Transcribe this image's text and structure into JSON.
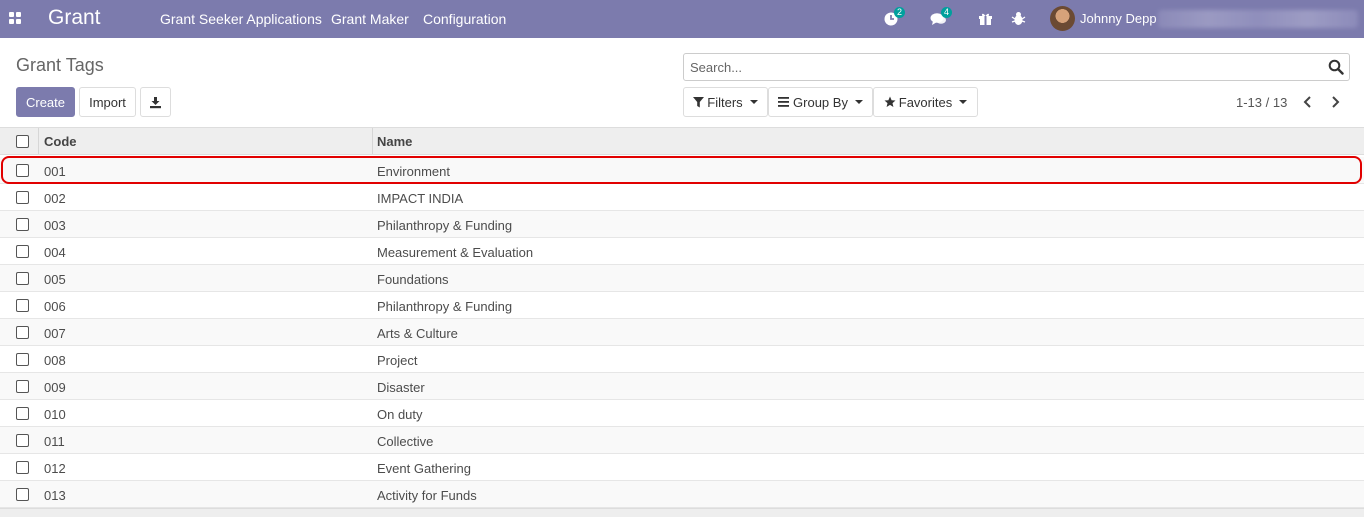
{
  "app": {
    "name": "Grant",
    "menu": [
      "Grant Seeker Applications",
      "Grant Maker",
      "Configuration"
    ]
  },
  "systray": {
    "activity_count": "2",
    "messages_count": "4",
    "user_name": "Johnny Depp"
  },
  "page": {
    "title": "Grant Tags",
    "create_label": "Create",
    "import_label": "Import",
    "search_placeholder": "Search...",
    "filters_label": "Filters",
    "groupby_label": "Group By",
    "favorites_label": "Favorites",
    "pager": "1-13 / 13"
  },
  "table": {
    "columns": [
      "Code",
      "Name"
    ],
    "rows": [
      {
        "code": "001",
        "name": "Environment"
      },
      {
        "code": "002",
        "name": "IMPACT INDIA"
      },
      {
        "code": "003",
        "name": "Philanthropy & Funding"
      },
      {
        "code": "004",
        "name": "Measurement & Evaluation"
      },
      {
        "code": "005",
        "name": "Foundations"
      },
      {
        "code": "006",
        "name": "Philanthropy & Funding"
      },
      {
        "code": "007",
        "name": "Arts & Culture"
      },
      {
        "code": "008",
        "name": "Project"
      },
      {
        "code": "009",
        "name": "Disaster"
      },
      {
        "code": "010",
        "name": "On duty"
      },
      {
        "code": "011",
        "name": "Collective"
      },
      {
        "code": "012",
        "name": "Event Gathering"
      },
      {
        "code": "013",
        "name": "Activity for Funds"
      }
    ]
  },
  "colors": {
    "navbar": "#7c7bad",
    "badge": "#00a09d",
    "highlight": "#e10000"
  },
  "icons": {
    "apps": "apps-grid-icon",
    "activity": "clock-icon",
    "messages": "chat-icon",
    "gift": "gift-icon",
    "debug": "bug-icon",
    "download": "download-icon",
    "search": "search-icon",
    "filters": "filter-icon",
    "groupby": "bars-icon",
    "favorites": "star-icon",
    "prev": "chevron-left-icon",
    "next": "chevron-right-icon"
  }
}
